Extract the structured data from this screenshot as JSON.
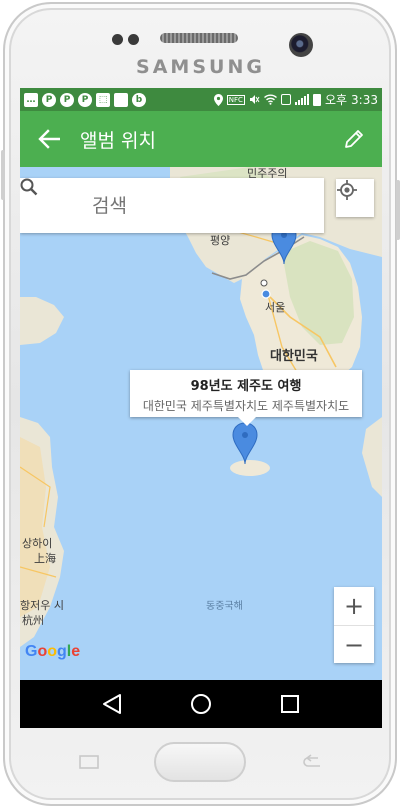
{
  "device": {
    "brand": "SAMSUNG"
  },
  "statusbar": {
    "time": "3:33",
    "ampm": "오후",
    "left_icons": [
      "message-icon",
      "pinterest-icon",
      "pinterest-icon",
      "pinterest-icon",
      "notification-icon",
      "square-app-icon",
      "b-app-icon"
    ],
    "right_icons": [
      "location-icon",
      "nfc-icon",
      "mute-icon",
      "wifi-icon",
      "sim-icon",
      "signal-icon",
      "battery-icon"
    ],
    "nfc_label": "NFC"
  },
  "appbar": {
    "title": "앨범 위치"
  },
  "search": {
    "placeholder": "검색"
  },
  "map": {
    "labels": {
      "north": "민주주의",
      "pyongyang": "평양",
      "seoul": "서울",
      "korea": "대한민국",
      "shanghai_ko": "상하이",
      "shanghai_cn": "上海",
      "hangzhou_ko": "항저우 시",
      "hangzhou_cn": "杭州",
      "sea": "동중국해"
    },
    "attribution": "Google"
  },
  "marker_info": {
    "title": "98년도 제주도 여행",
    "address": "대한민국 제주특별자치도 제주특별자치도"
  },
  "zoom": {
    "in": "+",
    "out": "−"
  },
  "colors": {
    "appbar": "#4caf50",
    "statusbar": "#3e8a3f",
    "water": "#a9d2f7",
    "marker": "#4a8be0"
  }
}
